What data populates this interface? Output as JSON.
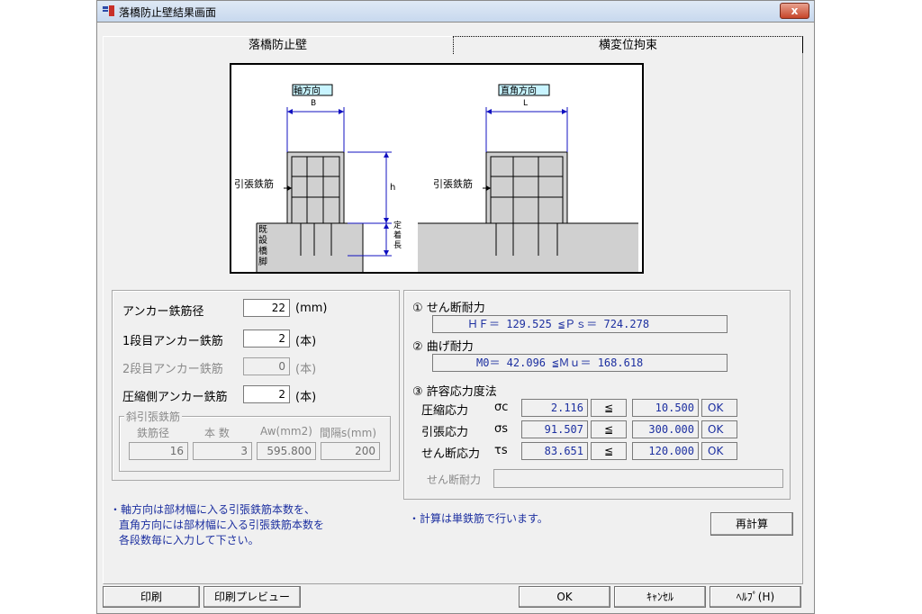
{
  "window": {
    "title": "落橋防止壁結果画面",
    "close_label": "x"
  },
  "tabs": [
    {
      "label": "落橋防止壁"
    },
    {
      "label": "横変位拘束"
    }
  ],
  "diagram": {
    "left_tag": "軸方向",
    "right_tag": "直角方向",
    "dim_b": "B",
    "dim_l": "L",
    "dim_h": "h",
    "left_rebar_label": "引張鉄筋",
    "right_rebar_label": "引張鉄筋",
    "pier_label": "既設橋脚",
    "anchor_label": "定着長"
  },
  "anchor": {
    "diameter_label": "アンカー鉄筋径",
    "diameter_value": "22",
    "diameter_unit": "(mm)",
    "row1_label": "1段目アンカー鉄筋",
    "row1_value": "2",
    "row1_unit": "(本)",
    "row2_label": "2段目アンカー鉄筋",
    "row2_value": "0",
    "row2_unit": "(本)",
    "comp_label": "圧縮側アンカー鉄筋",
    "comp_value": "2",
    "comp_unit": "(本)"
  },
  "diagonal": {
    "group_label": "斜引張鉄筋",
    "headers": [
      "鉄筋径",
      "本 数",
      "Aw(mm2)",
      "間隔s(mm)"
    ],
    "values": [
      "16",
      "3",
      "595.800",
      "200"
    ]
  },
  "results": {
    "shear_title": "① せん断耐力",
    "shear_text": "ＨＦ＝  129.525 ≦Ｐｓ＝  724.278",
    "bend_title": "② 曲げ耐力",
    "bend_text": "M0＝  42.096 ≦Ｍｕ＝  168.618",
    "allow_title": "③ 許容応力度法",
    "rows": [
      {
        "label": "圧縮応力",
        "symbol": "σc",
        "value": "2.116",
        "op": "≦",
        "limit": "10.500",
        "status": "OK"
      },
      {
        "label": "引張応力",
        "symbol": "σs",
        "value": "91.507",
        "op": "≦",
        "limit": "300.000",
        "status": "OK"
      },
      {
        "label": "せん断応力",
        "symbol": "τs",
        "value": "83.651",
        "op": "≦",
        "limit": "120.000",
        "status": "OK"
      }
    ],
    "shear_resist_label": "せん断耐力",
    "shear_resist_value": ""
  },
  "notes": {
    "left": [
      "・軸方向は部材幅に入る引張鉄筋本数を、",
      "直角方向には部材幅に入る引張鉄筋本数を",
      "各段数毎に入力して下さい。"
    ],
    "middle": "・計算は単鉄筋で行います。"
  },
  "buttons": {
    "recalc": "再計算",
    "print": "印刷",
    "preview": "印刷プレビュー",
    "ok": "OK",
    "cancel": "ｷｬﾝｾﾙ",
    "help": "ﾍﾙﾌﾟ(H)"
  }
}
